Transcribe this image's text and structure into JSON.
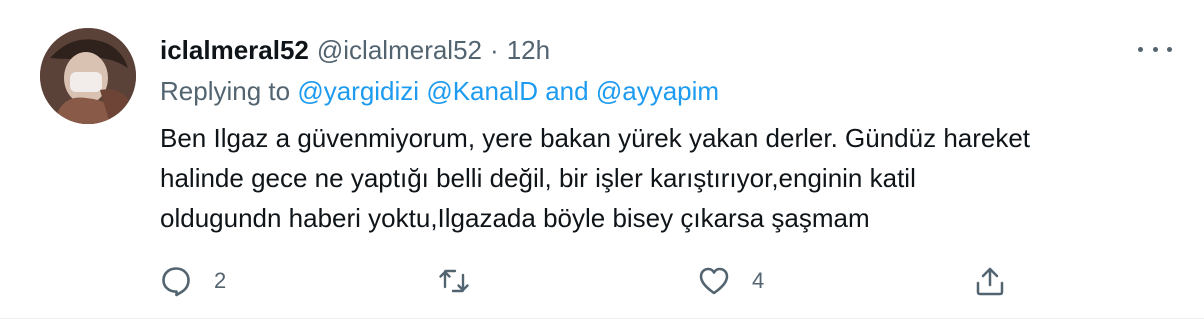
{
  "tweet": {
    "display_name": "iclalmeral52",
    "handle": "@iclalmeral52",
    "separator": "·",
    "time": "12h",
    "replying_prefix": "Replying to",
    "mentions": [
      "@yargidizi",
      "@KanalD"
    ],
    "mention_joiner": "and",
    "last_mention": "@ayyapim",
    "text_lines": [
      "Ben Ilgaz a güvenmiyorum, yere bakan yürek yakan derler. Gündüz hareket",
      "halinde gece ne yaptığı belli değil, bir işler karıştırıyor,enginin katil",
      "oldugundn  haberi yoktu,Ilgazada böyle bisey çıkarsa şaşmam"
    ]
  },
  "actions": {
    "reply_icon": "reply-icon",
    "reply_count": "2",
    "retweet_icon": "retweet-icon",
    "like_icon": "like-icon",
    "like_count": "4",
    "share_icon": "share-icon"
  },
  "colors": {
    "text": "#0f1419",
    "secondary": "#536471",
    "link": "#1d9bf0"
  }
}
